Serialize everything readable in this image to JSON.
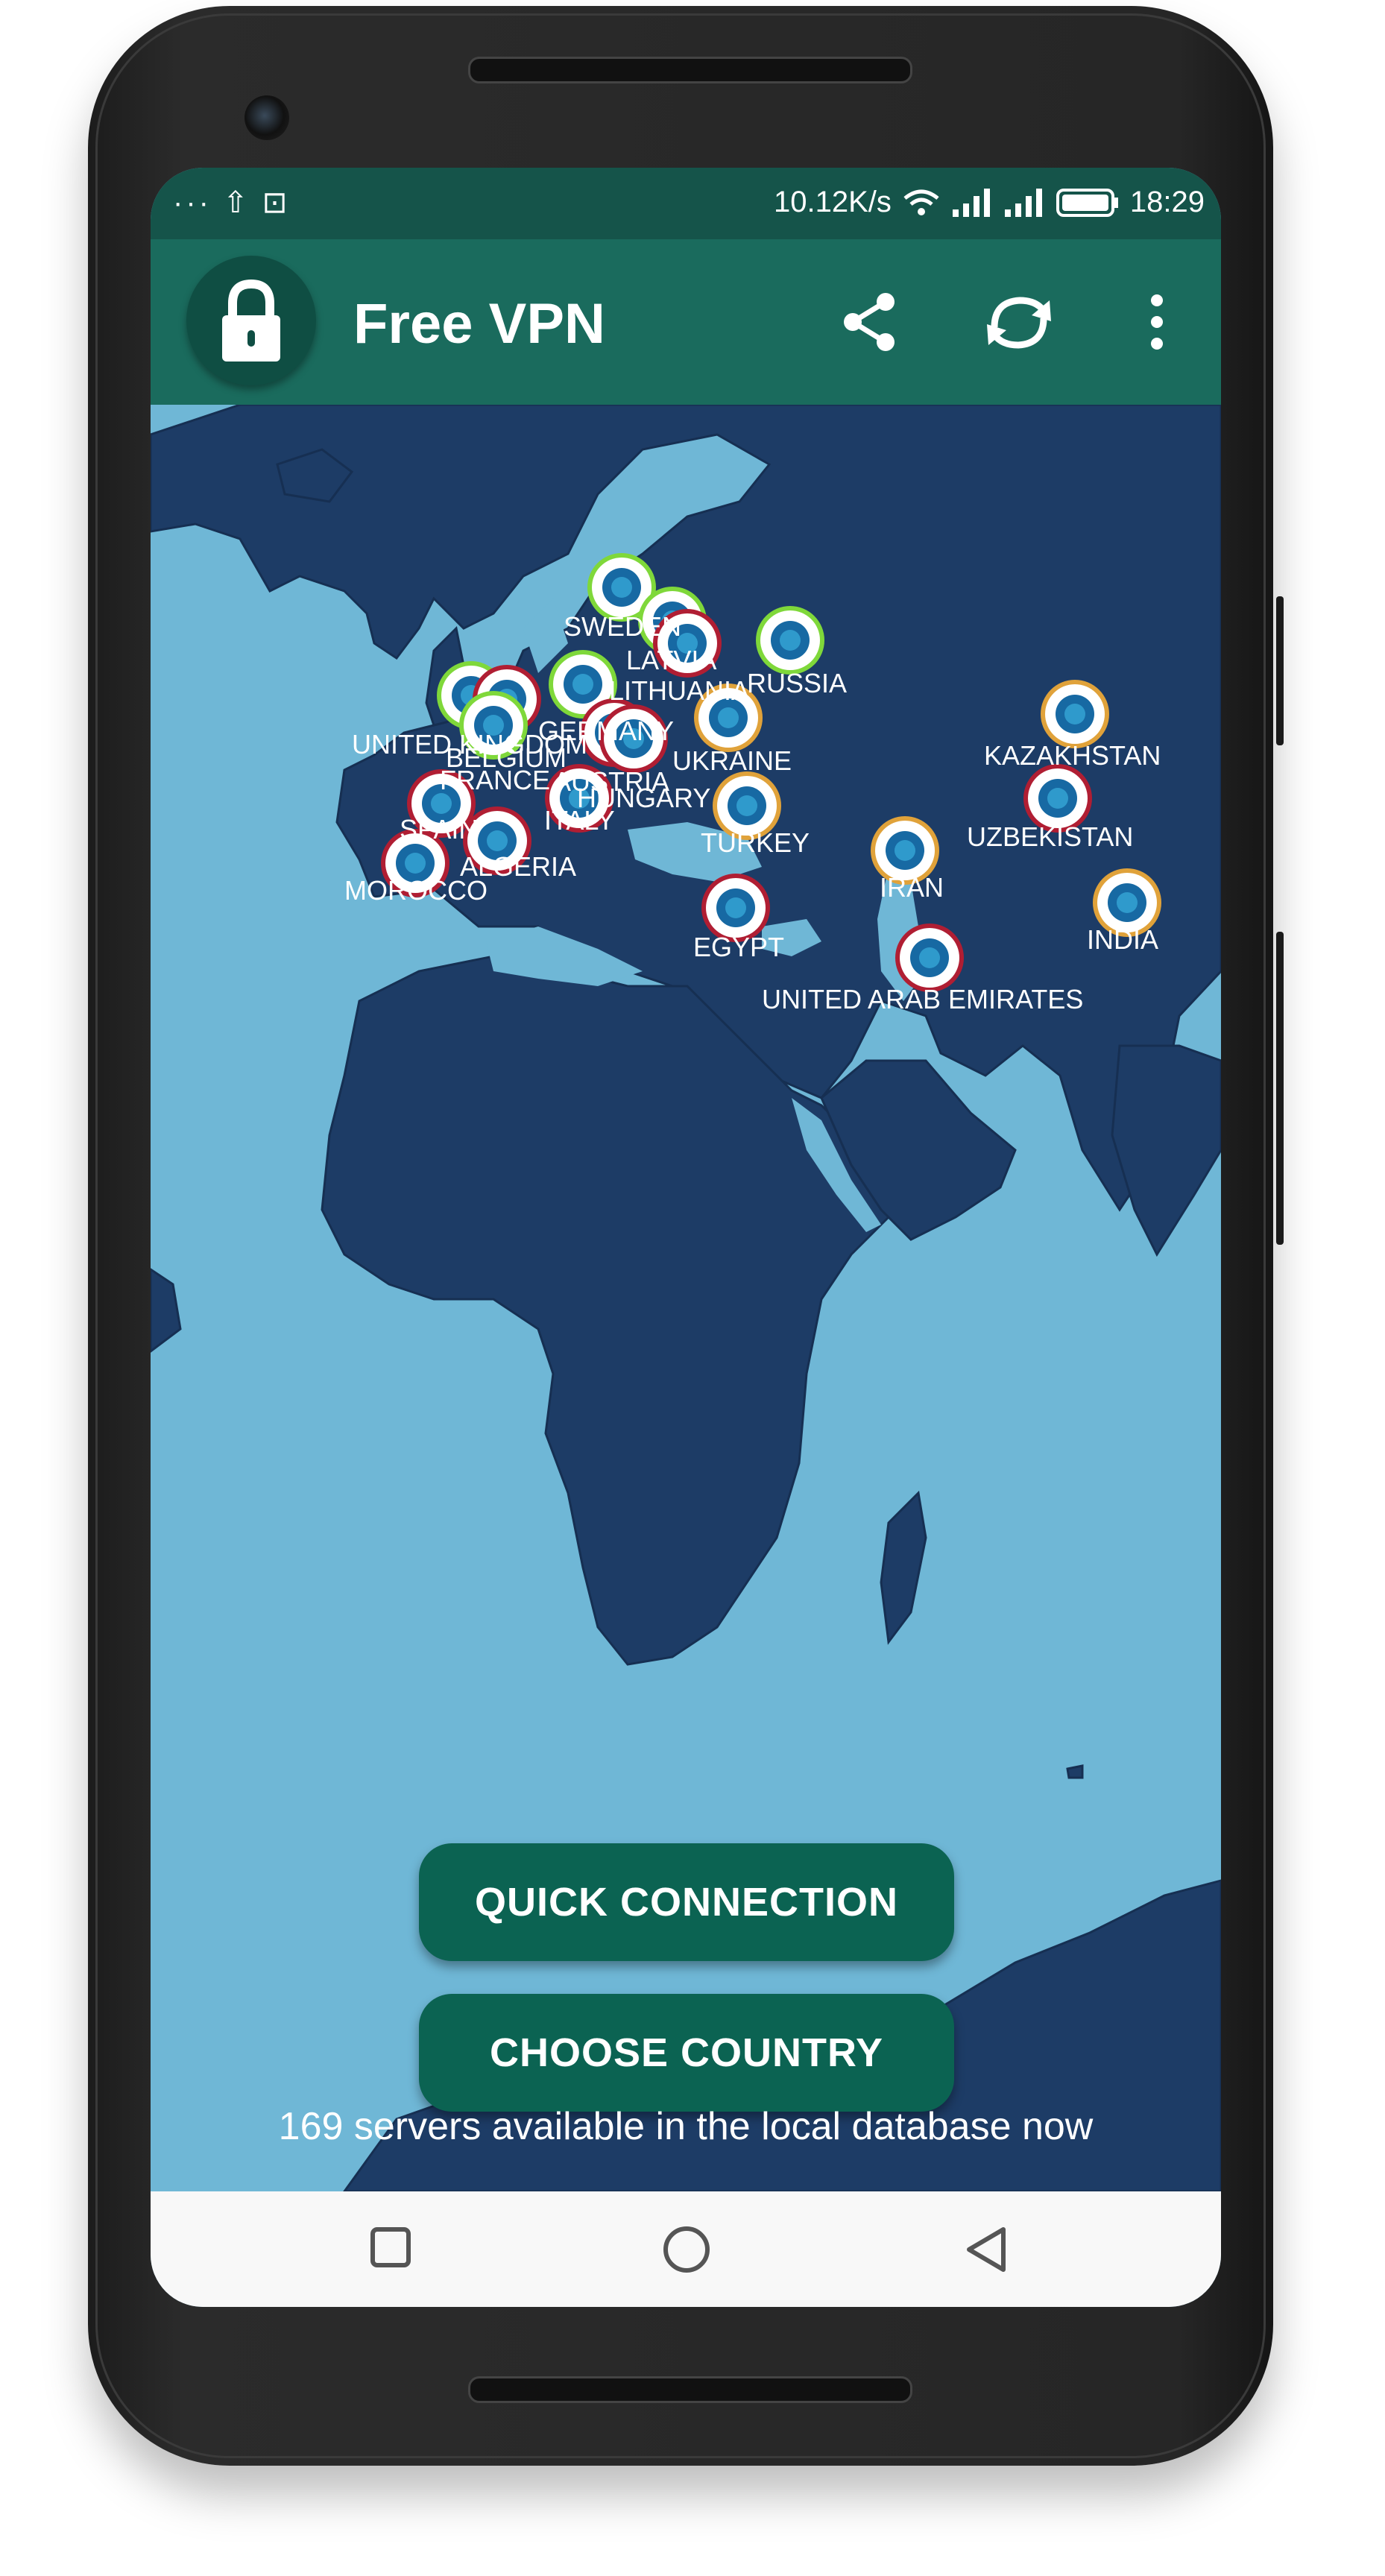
{
  "status_bar": {
    "left_icons": "··· ⇧ ⊡",
    "network_speed": "10.12K/s",
    "time": "18:29"
  },
  "app_bar": {
    "title": "Free VPN",
    "icons": [
      "lock-icon",
      "share-icon",
      "refresh-icon",
      "more-vert-icon"
    ]
  },
  "map": {
    "labels": [
      {
        "id": "sweden",
        "text": "SWEDEN"
      },
      {
        "id": "latvia",
        "text": "LATVIA"
      },
      {
        "id": "russia",
        "text": "RUSSIA"
      },
      {
        "id": "lithuania",
        "text": "LITHUANIA"
      },
      {
        "id": "germany",
        "text": "GERMANY"
      },
      {
        "id": "united-kingdom",
        "text": "UNITED KINGDOM"
      },
      {
        "id": "belgium",
        "text": "BELGIUM"
      },
      {
        "id": "france",
        "text": "FRANCE"
      },
      {
        "id": "austria",
        "text": "AUSTRIA"
      },
      {
        "id": "hungary",
        "text": "HUNGARY"
      },
      {
        "id": "ukraine",
        "text": "UKRAINE"
      },
      {
        "id": "kazakhstan",
        "text": "KAZAKHSTAN"
      },
      {
        "id": "spain",
        "text": "SPAIN"
      },
      {
        "id": "italy",
        "text": "ITALY"
      },
      {
        "id": "turkey",
        "text": "TURKEY"
      },
      {
        "id": "uzbekistan",
        "text": "UZBEKISTAN"
      },
      {
        "id": "algeria",
        "text": "ALGERIA"
      },
      {
        "id": "morocco",
        "text": "MOROCCO"
      },
      {
        "id": "iran",
        "text": "IRAN"
      },
      {
        "id": "egypt",
        "text": "EGYPT"
      },
      {
        "id": "india",
        "text": "INDIA"
      },
      {
        "id": "uae",
        "text": "UNITED ARAB EMIRATES"
      }
    ],
    "status_colors": {
      "green": "#7fd83a",
      "orange": "#e0a23a",
      "red": "#b01e33"
    }
  },
  "buttons": {
    "quick_connection": "QUICK CONNECTION",
    "choose_country": "CHOOSE COUNTRY"
  },
  "footer": {
    "servers_text": "169 servers available in the local database now"
  },
  "nav_bar": {
    "icons": [
      "recents-square-icon",
      "home-circle-icon",
      "back-triangle-icon"
    ]
  },
  "colors": {
    "status_bar": "#15544a",
    "app_bar": "#1a6b5d",
    "land": "#1d3c66",
    "water": "#6fb7d6",
    "button": "#0b6352"
  }
}
